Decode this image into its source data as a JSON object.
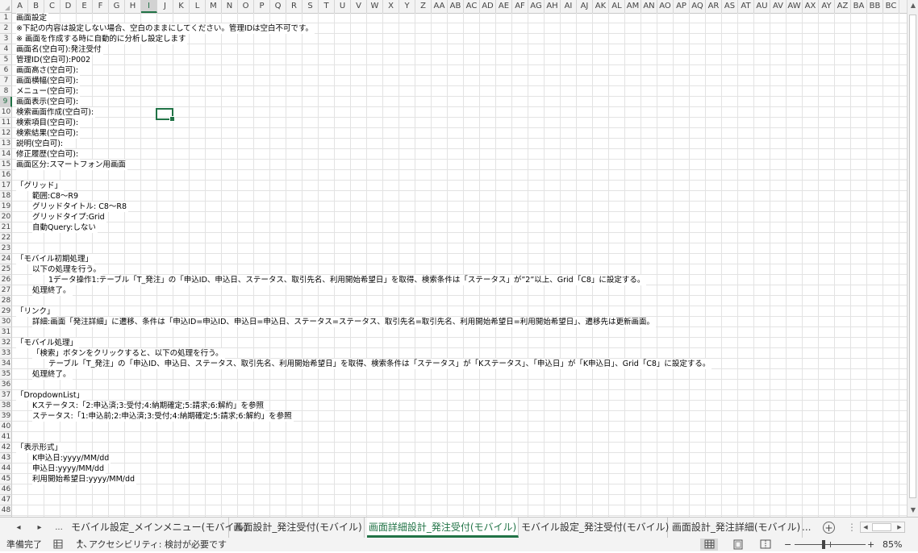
{
  "columns": [
    "A",
    "B",
    "C",
    "D",
    "E",
    "F",
    "G",
    "H",
    "I",
    "J",
    "K",
    "L",
    "M",
    "N",
    "O",
    "P",
    "Q",
    "R",
    "S",
    "T",
    "U",
    "V",
    "W",
    "X",
    "Y",
    "Z",
    "AA",
    "AB",
    "AC",
    "AD",
    "AE",
    "AF",
    "AG",
    "AH",
    "AI",
    "AJ",
    "AK",
    "AL",
    "AM",
    "AN",
    "AO",
    "AP",
    "AQ",
    "AR",
    "AS",
    "AT",
    "AU",
    "AV",
    "AW",
    "AX",
    "AY",
    "AZ",
    "BA",
    "BB",
    "BC"
  ],
  "selected_column": "I",
  "selected_row": "9",
  "rows": [
    "1",
    "2",
    "3",
    "4",
    "5",
    "6",
    "7",
    "8",
    "9",
    "10",
    "11",
    "12",
    "13",
    "14",
    "15",
    "16",
    "17",
    "18",
    "19",
    "20",
    "21",
    "22",
    "23",
    "24",
    "25",
    "26",
    "27",
    "28",
    "29",
    "30",
    "31",
    "32",
    "33",
    "34",
    "35",
    "36",
    "37",
    "38",
    "39",
    "40",
    "41",
    "42",
    "43",
    "44",
    "45",
    "46",
    "47",
    "48"
  ],
  "cells": [
    {
      "row": 1,
      "indent": 0,
      "text": "画面設定"
    },
    {
      "row": 2,
      "indent": 0,
      "text": "※下記の内容は設定しない場合、空白のままにしてください。管理IDは空白不可です。"
    },
    {
      "row": 3,
      "indent": 0,
      "text": "※ 画面を作成する時に自動的に分析し設定します"
    },
    {
      "row": 4,
      "indent": 0,
      "text": "画面名(空白可):発注受付"
    },
    {
      "row": 5,
      "indent": 0,
      "text": "管理ID(空白可):P002"
    },
    {
      "row": 6,
      "indent": 0,
      "text": "画面高さ(空白可):"
    },
    {
      "row": 7,
      "indent": 0,
      "text": "画面横幅(空白可):"
    },
    {
      "row": 8,
      "indent": 0,
      "text": "メニュー(空白可):"
    },
    {
      "row": 9,
      "indent": 0,
      "text": "画面表示(空白可):"
    },
    {
      "row": 10,
      "indent": 0,
      "text": "検索画面作成(空白可):"
    },
    {
      "row": 11,
      "indent": 0,
      "text": "検索項目(空白可):"
    },
    {
      "row": 12,
      "indent": 0,
      "text": "検索結果(空白可):"
    },
    {
      "row": 13,
      "indent": 0,
      "text": "説明(空白可):"
    },
    {
      "row": 14,
      "indent": 0,
      "text": "修正履歴(空白可):"
    },
    {
      "row": 15,
      "indent": 0,
      "text": "画面区分:スマートフォン用画面"
    },
    {
      "row": 17,
      "indent": 0,
      "text": "「グリッド」"
    },
    {
      "row": 18,
      "indent": 1,
      "text": "範囲:C8～R9"
    },
    {
      "row": 19,
      "indent": 1,
      "text": "グリッドタイトル: C8～R8"
    },
    {
      "row": 20,
      "indent": 1,
      "text": "グリッドタイプ:Grid"
    },
    {
      "row": 21,
      "indent": 1,
      "text": "自動Query:しない"
    },
    {
      "row": 24,
      "indent": 0,
      "text": "「モバイル初期処理」"
    },
    {
      "row": 25,
      "indent": 1,
      "text": "以下の処理を行う。"
    },
    {
      "row": 26,
      "indent": 2,
      "text": "1データ操作1:テーブル「T_発注」の「申込ID、申込日、ステータス、取引先名、利用開始希望日」を取得、検索条件は「ステータス」が”2”以上、Grid「C8」に設定する。"
    },
    {
      "row": 27,
      "indent": 1,
      "text": "処理終了。"
    },
    {
      "row": 29,
      "indent": 0,
      "text": "「リンク」"
    },
    {
      "row": 30,
      "indent": 1,
      "text": "詳細:画面「発注詳細」に遷移、条件は「申込ID=申込ID、申込日=申込日、ステータス=ステータス、取引先名=取引先名、利用開始希望日=利用開始希望日」、遷移先は更新画面。"
    },
    {
      "row": 32,
      "indent": 0,
      "text": "「モバイル処理」"
    },
    {
      "row": 33,
      "indent": 1,
      "text": "「検索」ボタンをクリックすると、以下の処理を行う。"
    },
    {
      "row": 34,
      "indent": 2,
      "text": "テーブル「T_発注」の「申込ID、申込日、ステータス、取引先名、利用開始希望日」を取得、検索条件は「ステータス」が「Kステータス」、「申込日」が「K申込日」、Grid「C8」に設定する。"
    },
    {
      "row": 35,
      "indent": 1,
      "text": "処理終了。"
    },
    {
      "row": 37,
      "indent": 0,
      "text": "「DropdownList」"
    },
    {
      "row": 38,
      "indent": 1,
      "text": "Kステータス:「2:申込済;3:受付;4:納期確定;5:請求;6:解約」を参照"
    },
    {
      "row": 39,
      "indent": 1,
      "text": "ステータス:「1:申込前;2:申込済;3:受付;4:納期確定;5:請求;6:解約」を参照"
    },
    {
      "row": 42,
      "indent": 0,
      "text": "「表示形式」"
    },
    {
      "row": 43,
      "indent": 1,
      "text": "K申込日:yyyy/MM/dd"
    },
    {
      "row": 44,
      "indent": 1,
      "text": "申込日:yyyy/MM/dd"
    },
    {
      "row": 45,
      "indent": 1,
      "text": "利用開始希望日:yyyy/MM/dd"
    }
  ],
  "sheet_tabs": {
    "nav_prev": "◂",
    "nav_next": "▸",
    "more_left": "...",
    "tabs": [
      {
        "label": "モバイル設定_メインメニュー(モバイル)",
        "active": false
      },
      {
        "label": "画面設計_発注受付(モバイル)",
        "active": false
      },
      {
        "label": "画面詳細設計_発注受付(モバイル)",
        "active": true
      },
      {
        "label": "モバイル設定_発注受付(モバイル)",
        "active": false
      },
      {
        "label": "画面設計_発注詳細(モバイル)",
        "active": false
      }
    ],
    "more_right": "...",
    "add_sheet": "+"
  },
  "status": {
    "ready": "準備完了",
    "accessibility": "アクセシビリティ: 検討が必要です",
    "zoom_minus": "−",
    "zoom_plus": "+",
    "zoom": "85%",
    "zoom_level_percent": 85
  },
  "colors": {
    "accent": "#217346",
    "header_bg": "#f3f3f3",
    "grid_line": "#e3e3e3"
  }
}
